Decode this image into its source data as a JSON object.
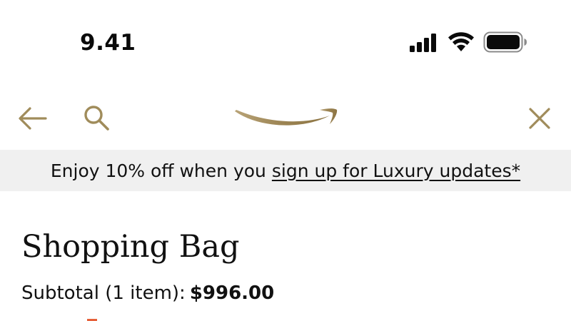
{
  "status_bar": {
    "time": "9.41",
    "icons": [
      "cellular-signal-icon",
      "wifi-icon",
      "battery-icon"
    ]
  },
  "nav": {
    "icons": [
      "arrow-left-icon",
      "search-icon",
      "amazon-smile-logo",
      "close-icon"
    ],
    "accent_color": "#a08c5b"
  },
  "promo": {
    "text": "Enjoy 10% off when you",
    "link": "sign up for Luxury updates*",
    "background": "#f0f0f0"
  },
  "page": {
    "title": "Shopping Bag"
  },
  "subtotal": {
    "label": "Subtotal (1 item):",
    "amount": "$996.00"
  }
}
